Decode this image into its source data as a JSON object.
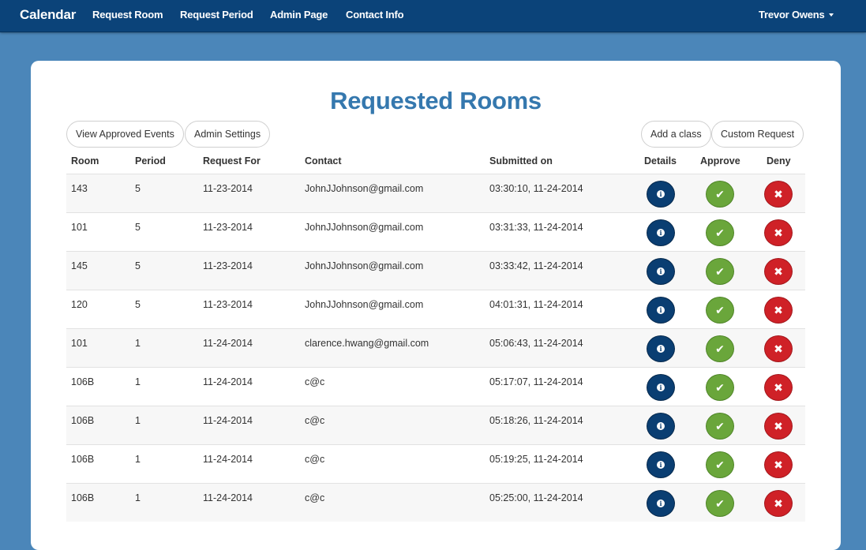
{
  "navbar": {
    "brand": "Calendar",
    "links": [
      "Request Room",
      "Request Period",
      "Admin Page",
      "Contact Info"
    ],
    "user": "Trevor Owens"
  },
  "page": {
    "title": "Requested Rooms",
    "buttons": {
      "view_approved": "View Approved Events",
      "admin_settings": "Admin Settings",
      "add_class": "Add a class",
      "custom_request": "Custom Request"
    }
  },
  "table": {
    "headers": [
      "Room",
      "Period",
      "Request For",
      "Contact",
      "Submitted on",
      "Details",
      "Approve",
      "Deny"
    ],
    "rows": [
      [
        "143",
        "5",
        "11-23-2014",
        "JohnJJohnson@gmail.com",
        "03:30:10, 11-24-2014"
      ],
      [
        "101",
        "5",
        "11-23-2014",
        "JohnJJohnson@gmail.com",
        "03:31:33, 11-24-2014"
      ],
      [
        "145",
        "5",
        "11-23-2014",
        "JohnJJohnson@gmail.com",
        "03:33:42, 11-24-2014"
      ],
      [
        "120",
        "5",
        "11-23-2014",
        "JohnJJohnson@gmail.com",
        "04:01:31, 11-24-2014"
      ],
      [
        "101",
        "1",
        "11-24-2014",
        "clarence.hwang@gmail.com",
        "05:06:43, 11-24-2014"
      ],
      [
        "106B",
        "1",
        "11-24-2014",
        "c@c",
        "05:17:07, 11-24-2014"
      ],
      [
        "106B",
        "1",
        "11-24-2014",
        "c@c",
        "05:18:26, 11-24-2014"
      ],
      [
        "106B",
        "1",
        "11-24-2014",
        "c@c",
        "05:19:25, 11-24-2014"
      ],
      [
        "106B",
        "1",
        "11-24-2014",
        "c@c",
        "05:25:00, 11-24-2014"
      ]
    ]
  },
  "icons": {
    "details": "info-icon",
    "approve": "check-icon",
    "deny": "x-icon"
  },
  "colors": {
    "navbar": "#0b4379",
    "background": "#4b86b9",
    "title": "#3578ae",
    "details": "#0a3e72",
    "approve": "#6aa63b",
    "deny": "#cf2127"
  }
}
